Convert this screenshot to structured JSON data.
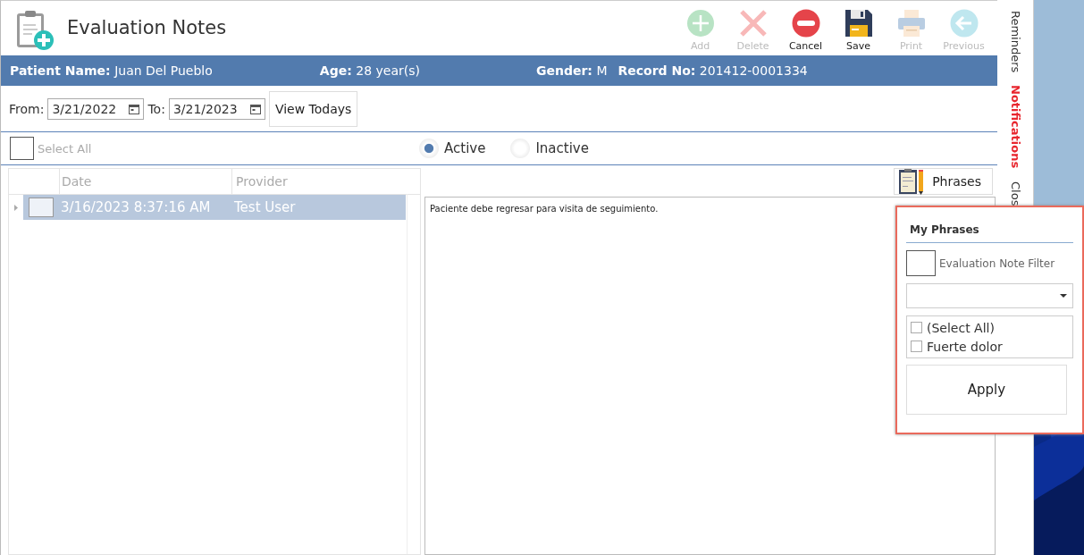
{
  "window": {
    "title": "Evaluation Notes"
  },
  "toolbar": [
    {
      "label": "Add",
      "kind": "add",
      "disabled": true
    },
    {
      "label": "Delete",
      "kind": "delete",
      "disabled": true
    },
    {
      "label": "Cancel",
      "kind": "cancel",
      "disabled": false
    },
    {
      "label": "Save",
      "kind": "save",
      "disabled": false
    },
    {
      "label": "Print",
      "kind": "print",
      "disabled": true
    },
    {
      "label": "Previous",
      "kind": "previous",
      "disabled": true
    }
  ],
  "patient": [
    {
      "label": "Patient Name:",
      "value": "Juan Del Pueblo"
    },
    {
      "label": "Age:",
      "value": "28 year(s)"
    },
    {
      "label": "Gender:",
      "value": "M"
    },
    {
      "label": "Record No:",
      "value": "201412-0001334"
    }
  ],
  "filter": {
    "from_label": "From:",
    "from": "3/21/2022",
    "to_label": "To:",
    "to": "3/21/2023",
    "button": "View Todays"
  },
  "select_all": {
    "label": "Select All",
    "checked": false
  },
  "status": [
    {
      "label": "Active",
      "selected": true
    },
    {
      "label": "Inactive",
      "selected": false
    }
  ],
  "grid": {
    "columns": [
      "Date",
      "Provider"
    ],
    "rows": [
      {
        "date": "3/16/2023 8:37:16 AM",
        "provider": "Test User",
        "selected": true,
        "checked": false
      }
    ]
  },
  "note": "Paciente debe regresar para visita de seguimiento.",
  "phrases_button": "Phrases",
  "phrases_popup": {
    "title": "My Phrases",
    "filter": {
      "label": "Evaluation Note Filter",
      "checked": false
    },
    "items": [
      {
        "label": "(Select All)",
        "checked": false
      },
      {
        "label": "Fuerte dolor",
        "checked": false
      }
    ],
    "apply": "Apply"
  },
  "side_tabs": [
    {
      "label": "Reminders",
      "selected": false
    },
    {
      "label": "Notifications",
      "selected": true
    },
    {
      "label": "Clos",
      "selected": false
    }
  ]
}
